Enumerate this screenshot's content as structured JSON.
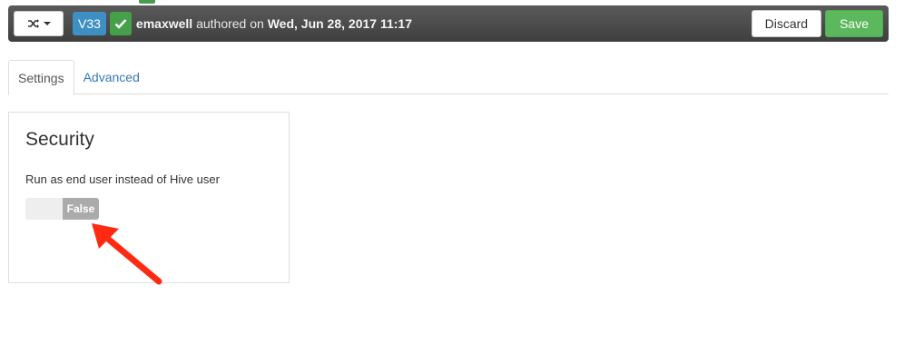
{
  "version_bar": {
    "version": "V33",
    "author": "emaxwell",
    "authored_text": " authored on ",
    "date": "Wed, Jun 28, 2017 11:17",
    "discard_label": "Discard",
    "save_label": "Save",
    "history_icon": "shuffle-icon",
    "current_icon": "check-icon"
  },
  "tabs": [
    {
      "label": "Settings",
      "active": true
    },
    {
      "label": "Advanced",
      "active": false
    }
  ],
  "security": {
    "title": "Security",
    "label": "Run as end user instead of Hive user",
    "toggle_value": "False"
  },
  "colors": {
    "bar_bg": "#4a4a4a",
    "version_badge": "#3d8fc4",
    "current_badge": "#46a04a",
    "save_button": "#5cb85c",
    "link": "#337ab7",
    "annotation_arrow": "#ff2a12"
  }
}
